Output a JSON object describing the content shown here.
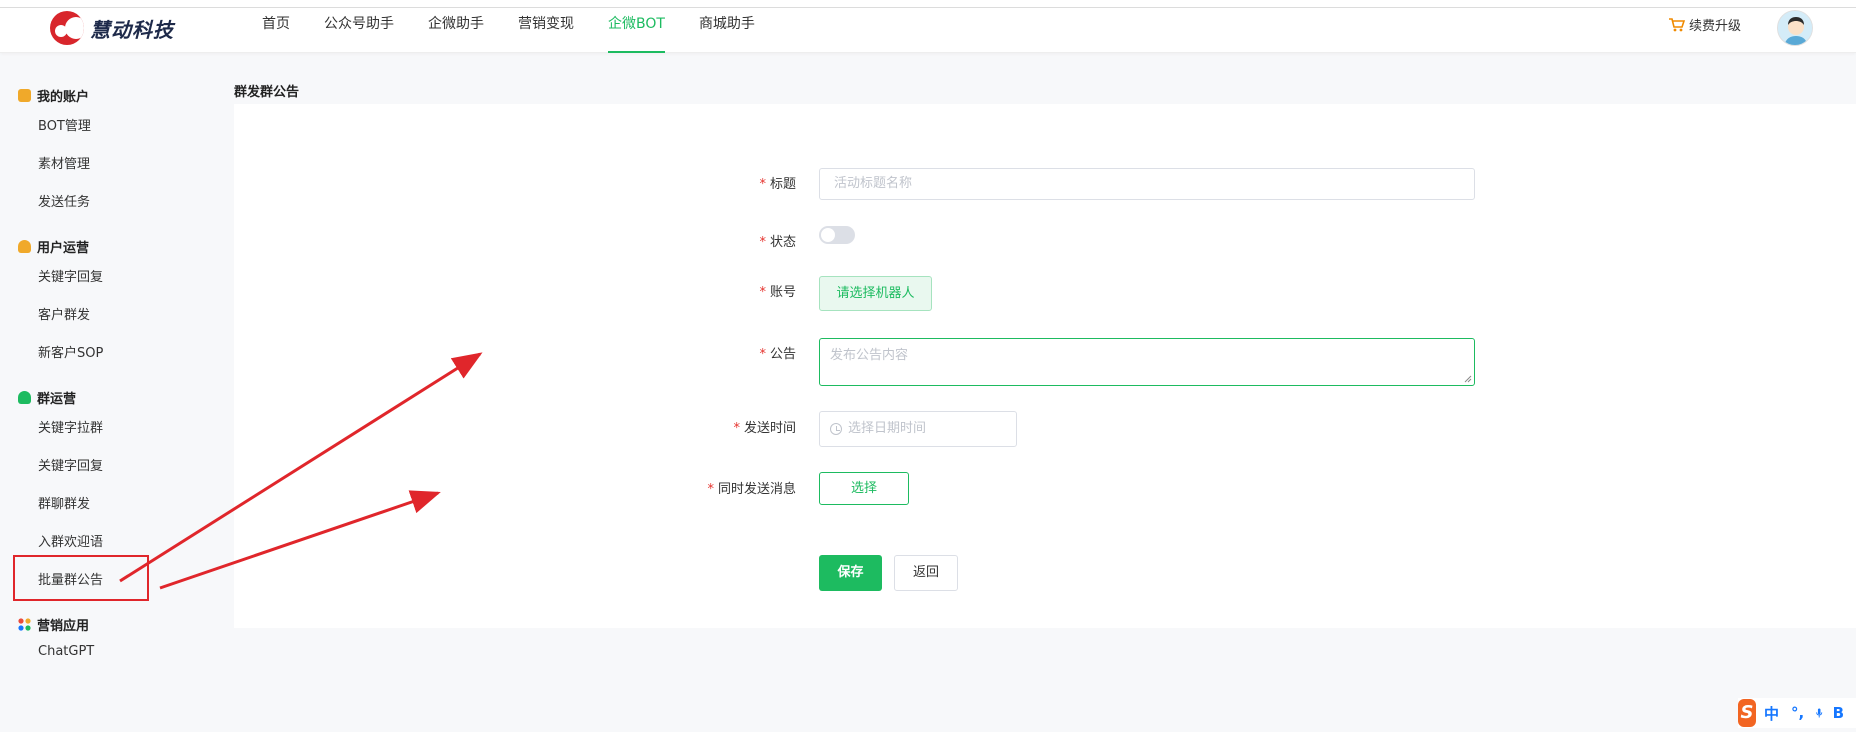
{
  "brand": {
    "name": "慧动科技"
  },
  "nav": [
    {
      "label": "首页"
    },
    {
      "label": "公众号助手"
    },
    {
      "label": "企微助手"
    },
    {
      "label": "营销变现"
    },
    {
      "label": "企微BOT",
      "active": true
    },
    {
      "label": "商城助手"
    }
  ],
  "header": {
    "renew_label": "续费升级",
    "cart_icon": "cart-icon",
    "avatar_icon": "user-avatar"
  },
  "sidebar": {
    "groups": [
      {
        "title": "我的账户",
        "icon": "account-icon",
        "color": "#f0a92a",
        "items": [
          "BOT管理",
          "素材管理",
          "发送任务"
        ]
      },
      {
        "title": "用户运营",
        "icon": "user-icon",
        "color": "#f0a92a",
        "items": [
          "关键字回复",
          "客户群发",
          "新客户SOP"
        ]
      },
      {
        "title": "群运营",
        "icon": "group-icon",
        "color": "#1dbb60",
        "items": [
          "关键字拉群",
          "关键字回复",
          "群聊群发",
          "入群欢迎语",
          "批量群公告"
        ]
      },
      {
        "title": "营销应用",
        "icon": "apps-icon",
        "color": "#ea4c3c",
        "items": [
          "ChatGPT"
        ]
      }
    ]
  },
  "breadcrumb": "群发群公告",
  "form": {
    "title_label": "标题",
    "title_placeholder": "活动标题名称",
    "status_label": "状态",
    "status_on": false,
    "account_label": "账号",
    "account_button": "请选择机器人",
    "notice_label": "公告",
    "notice_placeholder": "发布公告内容",
    "send_time_label": "发送时间",
    "send_time_placeholder": "选择日期时间",
    "sync_label": "同时发送消息",
    "select_button": "选择",
    "required_mark": "*",
    "save_button": "保存",
    "back_button": "返回"
  },
  "ime": {
    "logo": "S",
    "lang": "中",
    "punct": "°,",
    "mic_icon": "mic-icon",
    "extra": "B"
  },
  "colors": {
    "accent": "#1dbb60",
    "annotation": "#e0262b"
  }
}
